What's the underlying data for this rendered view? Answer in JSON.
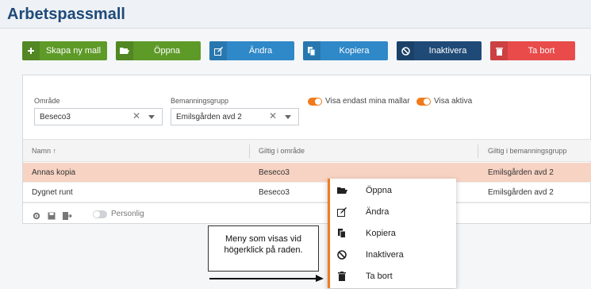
{
  "page": {
    "title": "Arbetspassmall"
  },
  "toolbar": {
    "buttons": [
      {
        "label": "Skapa ny mall",
        "icon": "plus-icon",
        "color": "#5e9a28"
      },
      {
        "label": "Öppna",
        "icon": "folder-open-icon",
        "color": "#5e9a28"
      },
      {
        "label": "Ändra",
        "icon": "edit-icon",
        "color": "#2f88c8"
      },
      {
        "label": "Kopiera",
        "icon": "copy-icon",
        "color": "#2f88c8"
      },
      {
        "label": "Inaktivera",
        "icon": "ban-icon",
        "color": "#1f4a77"
      },
      {
        "label": "Ta bort",
        "icon": "trash-icon",
        "color": "#e94b4b"
      }
    ]
  },
  "filters": {
    "omrade": {
      "label": "Område",
      "value": "Beseco3"
    },
    "bemanningsgrupp": {
      "label": "Bemanningsgrupp",
      "value": "Emilsgården avd 2"
    },
    "toggle_mina": {
      "label": "Visa endast mina mallar",
      "on": true
    },
    "toggle_aktiva": {
      "label": "Visa aktiva",
      "on": true
    }
  },
  "grid": {
    "columns": [
      "Namn ↑",
      "Giltig i område",
      "Giltig i bemanningsgrupp"
    ],
    "rows": [
      {
        "namn": "Annas kopia",
        "omrade": "Beseco3",
        "grupp": "Emilsgården avd 2",
        "selected": true
      },
      {
        "namn": "Dygnet runt",
        "omrade": "Beseco3",
        "grupp": "Emilsgården avd 2",
        "selected": false
      }
    ],
    "footer": {
      "personlig_label": "Personlig"
    }
  },
  "context_menu": {
    "items": [
      {
        "label": "Öppna",
        "icon": "folder-open-icon"
      },
      {
        "label": "Ändra",
        "icon": "edit-icon"
      },
      {
        "label": "Kopiera",
        "icon": "copy-icon"
      },
      {
        "label": "Inaktivera",
        "icon": "ban-icon"
      },
      {
        "label": "Ta bort",
        "icon": "trash-icon"
      }
    ]
  },
  "callout": {
    "line1": "Meny som visas vid",
    "line2": "högerklick på raden."
  },
  "colors": {
    "accent": "#f07b1c",
    "title": "#1e4a79",
    "selected_row": "#f7d3c3"
  }
}
